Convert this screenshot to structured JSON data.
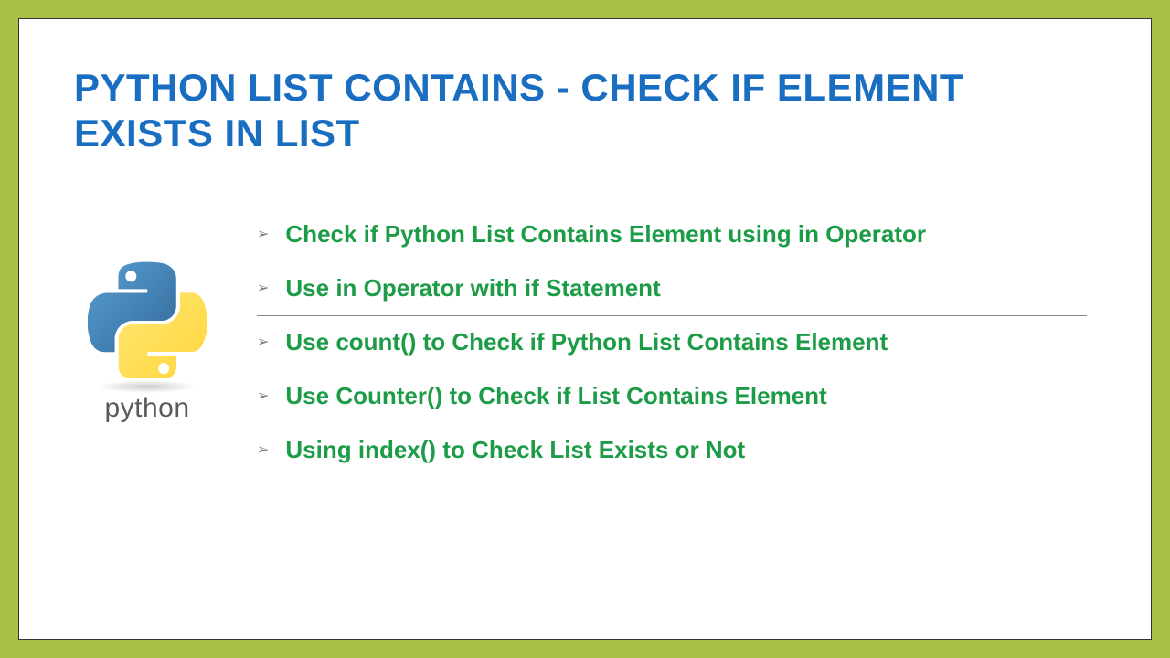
{
  "title": "PYTHON LIST CONTAINS - CHECK IF ELEMENT EXISTS IN LIST",
  "logo": {
    "label": "python"
  },
  "items": [
    "Check if Python List Contains Element using in Operator",
    "Use in Operator with if Statement",
    "Use count() to Check if Python List Contains Element",
    "Use Counter() to Check if List Contains Element",
    "Using index() to Check List Exists or Not"
  ]
}
